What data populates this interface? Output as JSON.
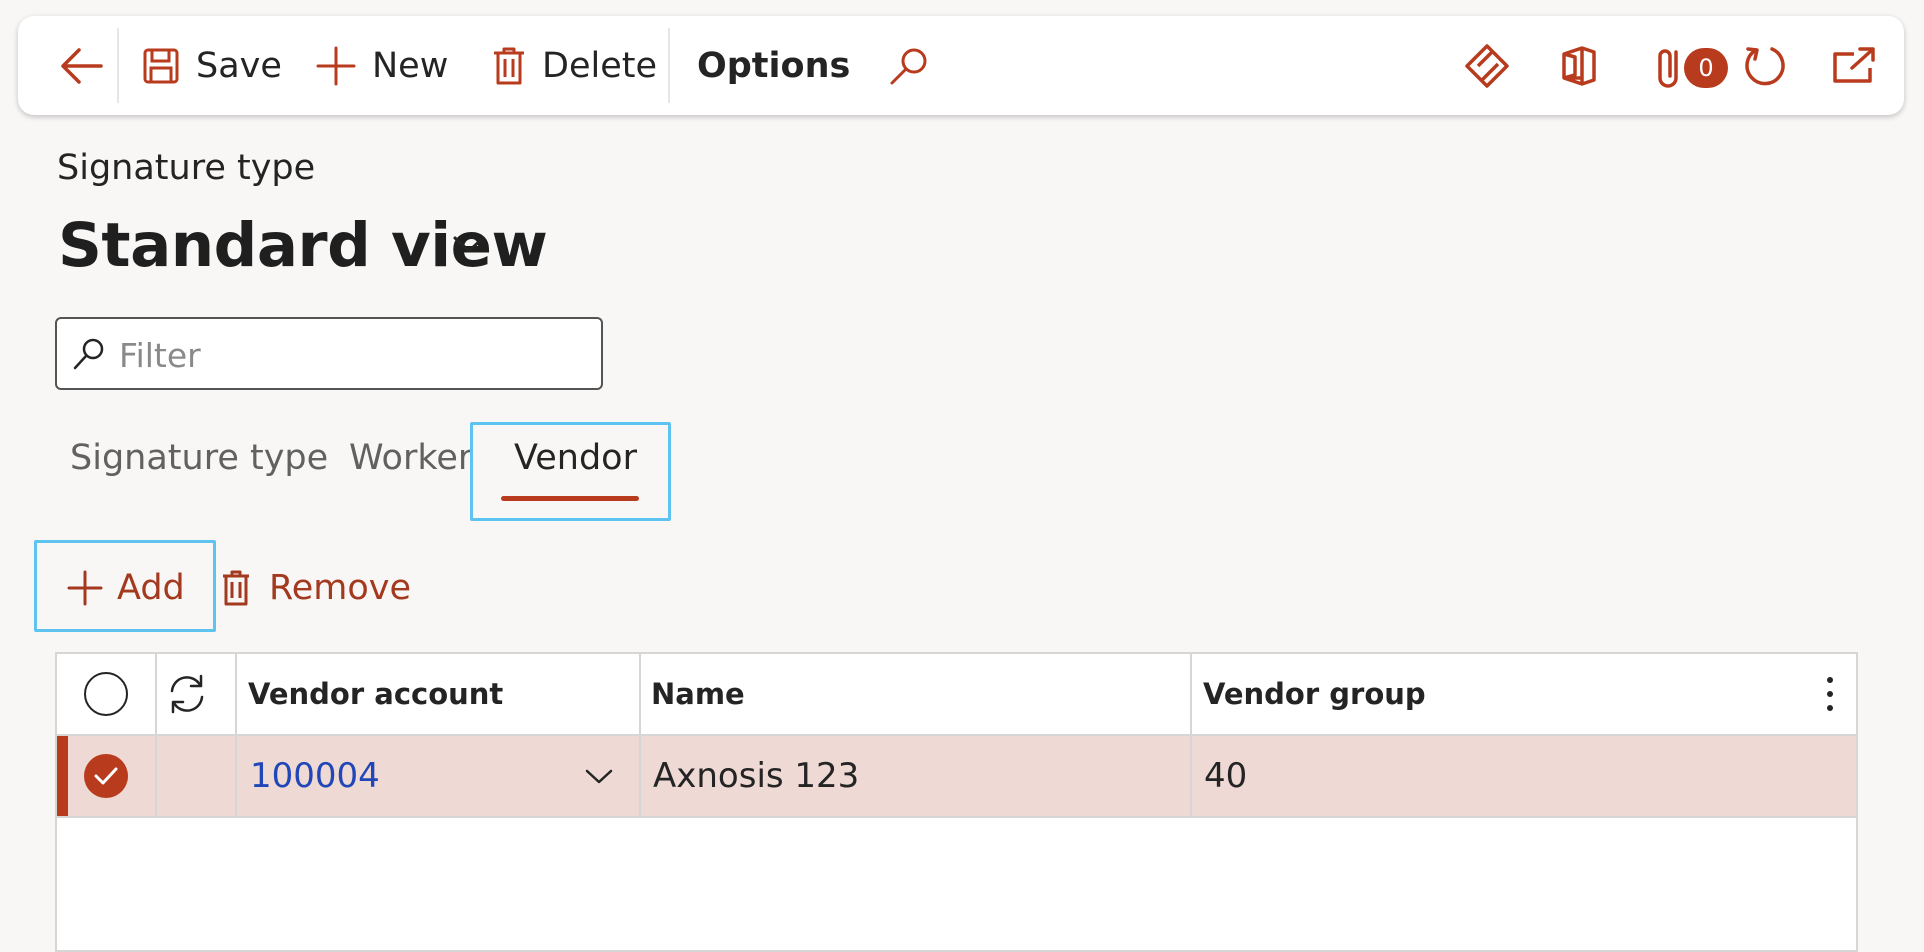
{
  "toolbar": {
    "save_label": "Save",
    "new_label": "New",
    "delete_label": "Delete",
    "options_label": "Options",
    "attachments_badge": "0"
  },
  "page": {
    "caption": "Signature type",
    "view_title": "Standard view"
  },
  "filter": {
    "placeholder": "Filter",
    "value": ""
  },
  "tabs": [
    {
      "label": "Signature type",
      "selected": false
    },
    {
      "label": "Worker",
      "selected": false
    },
    {
      "label": "Vendor",
      "selected": true
    }
  ],
  "actions": {
    "add_label": "Add",
    "remove_label": "Remove"
  },
  "grid": {
    "columns": [
      "Vendor account",
      "Name",
      "Vendor group"
    ],
    "rows": [
      {
        "vendor_account": "100004",
        "name": "Axnosis 123",
        "vendor_group": "40",
        "selected": true
      }
    ]
  },
  "colors": {
    "accent": "#b83b1e",
    "link": "#2046b8",
    "selected_row": "#eed9d4",
    "focus": "#5ec3f0"
  },
  "icons": [
    "back-arrow-icon",
    "save-icon",
    "plus-icon",
    "trash-icon",
    "search-icon",
    "power-apps-icon",
    "office-icon",
    "paperclip-icon",
    "refresh-icon",
    "open-in-new-icon",
    "chevron-down-icon",
    "filter-search-icon",
    "select-all-circle-icon",
    "refresh-column-icon",
    "more-vertical-icon",
    "checkmark-circle-icon"
  ]
}
